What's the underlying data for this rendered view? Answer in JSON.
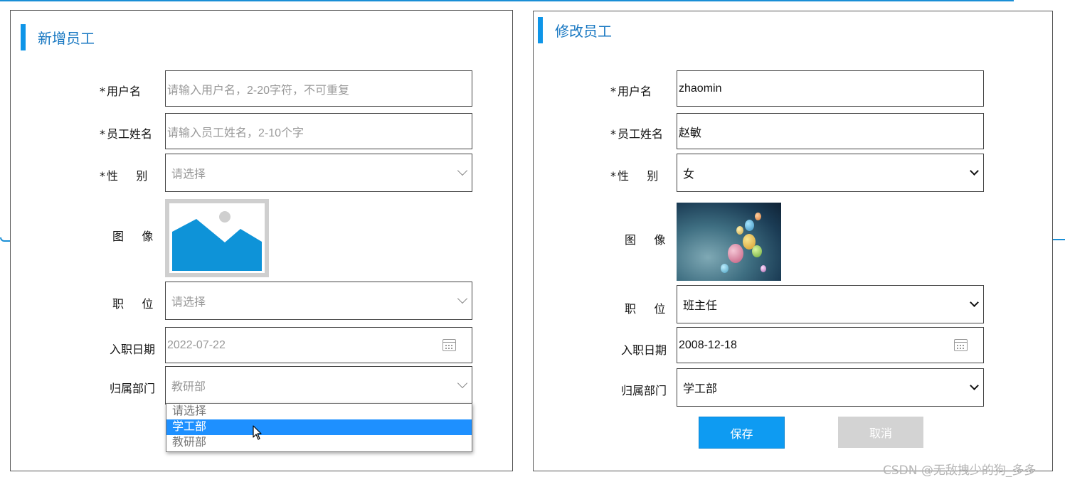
{
  "add_form": {
    "title": "新增员工",
    "fields": {
      "username": {
        "label": "用户名",
        "required": "*",
        "placeholder": "请输入用户名，2-20字符，不可重复"
      },
      "name": {
        "label": "员工姓名",
        "required": "*",
        "placeholder": "请输入员工姓名，2-10个字"
      },
      "gender": {
        "label": "性     别",
        "required": "*",
        "placeholder": "请选择"
      },
      "image": {
        "label": "图     像"
      },
      "job": {
        "label": "职     位",
        "placeholder": "请选择"
      },
      "entry_date": {
        "label": "入职日期",
        "value": "2022-07-22"
      },
      "department": {
        "label": "归属部门",
        "value": "教研部",
        "options": [
          "请选择",
          "学工部",
          "教研部"
        ],
        "highlighted_option": "学工部"
      }
    }
  },
  "edit_form": {
    "title": "修改员工",
    "fields": {
      "username": {
        "label": "用户名",
        "required": "*",
        "value": "zhaomin"
      },
      "name": {
        "label": "员工姓名",
        "required": "*",
        "value": "赵敏"
      },
      "gender": {
        "label": "性     别",
        "required": "*",
        "value": "女"
      },
      "image": {
        "label": "图     像"
      },
      "job": {
        "label": "职     位",
        "value": "班主任"
      },
      "entry_date": {
        "label": "入职日期",
        "value": "2008-12-18"
      },
      "department": {
        "label": "归属部门",
        "value": "学工部"
      }
    },
    "buttons": {
      "save": "保存",
      "cancel": "取消"
    }
  },
  "watermark": "CSDN @无敌拽少的狗_多多",
  "colors": {
    "accent": "#0e95e8",
    "title_text": "#1576c1",
    "selected_option": "#1e90ff",
    "cancel_button": "#d3d3d3"
  }
}
